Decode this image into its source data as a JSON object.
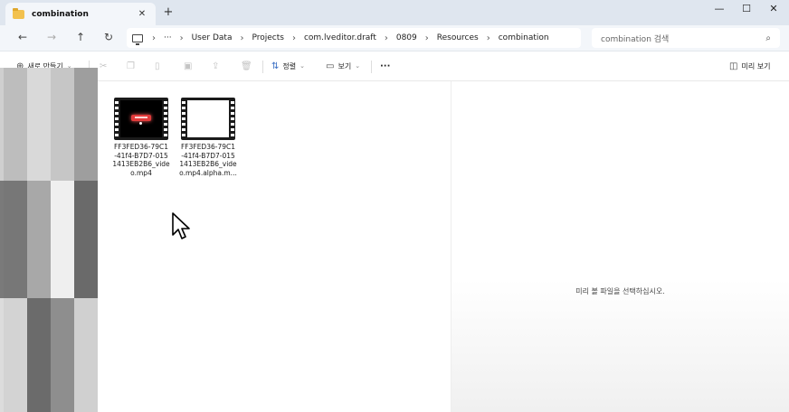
{
  "window": {
    "tab_title": "combination",
    "tab_close": "✕",
    "new_tab": "+",
    "minimize": "—",
    "maximize": "☐",
    "close": "✕"
  },
  "nav": {
    "back": "←",
    "forward": "→",
    "up": "↑",
    "refresh": "↻",
    "more_crumbs": "···",
    "breadcrumbs": [
      "User Data",
      "Projects",
      "com.lveditor.draft",
      "0809",
      "Resources",
      "combination"
    ],
    "search_placeholder": "combination 검색"
  },
  "toolbar": {
    "new_label": "새로 만들기",
    "sort_label": "정렬",
    "view_label": "보기",
    "more": "···",
    "preview_label": "미리 보기"
  },
  "files": [
    {
      "name_lines": [
        "FF3FED36-79C1",
        "-41f4-B7D7-015",
        "1413EB2B6_vide",
        "o.mp4"
      ]
    },
    {
      "name_lines": [
        "FF3FED36-79C1",
        "-41f4-B7D7-015",
        "1413EB2B6_vide",
        "o.mp4.alpha.m..."
      ]
    }
  ],
  "preview": {
    "message": "미리 볼 파일을 선택하십시오."
  },
  "colors": {
    "titlebar": "#dfe6ef",
    "navbar": "#f3f6fa",
    "folder": "#f2c14e",
    "thumb_accent": "#e23b3b"
  }
}
